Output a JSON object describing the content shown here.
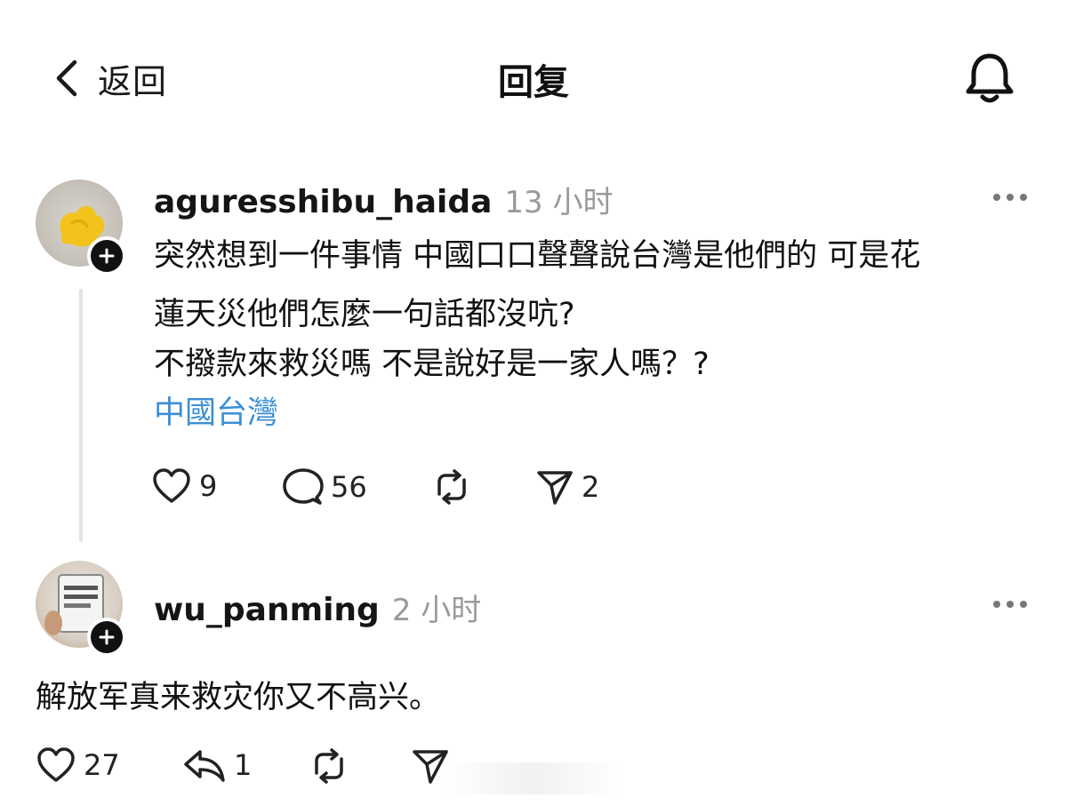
{
  "header": {
    "back_label": "返回",
    "title": "回复"
  },
  "post": {
    "username": "aguresshibu_haida",
    "time": "13 小时",
    "lines": [
      "突然想到一件事情 中國口口聲聲說台灣是他們的 可是花",
      "蓮天災他們怎麼一句話都沒吭?",
      "不撥款來救災嗎 不是說好是一家人嗎？?"
    ],
    "tag": "中國台灣",
    "actions": {
      "likes": "9",
      "comments": "56",
      "shares": "2"
    }
  },
  "reply": {
    "username": "wu_panming",
    "time": "2 小时",
    "text": "解放军真来救灾你又不高兴。",
    "actions": {
      "likes": "27",
      "replies": "1"
    }
  },
  "icons": {
    "back": "chevron-left-icon",
    "bell": "bell-icon",
    "more": "more-dots-icon",
    "like": "heart-icon",
    "comment": "comment-bubble-icon",
    "repost": "repost-icon",
    "share": "send-icon",
    "reply": "reply-arrow-icon",
    "follow": "plus-icon"
  },
  "colors": {
    "tag": "#3b8fd6",
    "muted": "#9a9a9a",
    "text": "#111111"
  }
}
